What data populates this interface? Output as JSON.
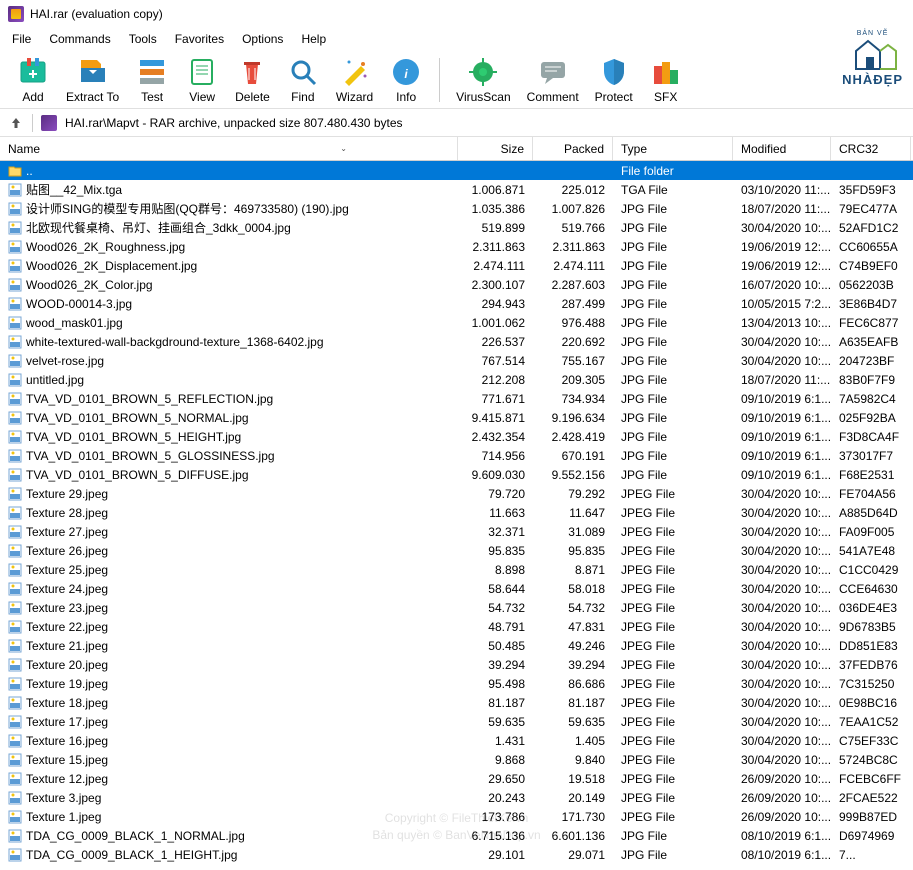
{
  "title": "HAI.rar (evaluation copy)",
  "menus": [
    "File",
    "Commands",
    "Tools",
    "Favorites",
    "Options",
    "Help"
  ],
  "toolbar": [
    {
      "label": "Add",
      "icon": "add"
    },
    {
      "label": "Extract To",
      "icon": "extract"
    },
    {
      "label": "Test",
      "icon": "test"
    },
    {
      "label": "View",
      "icon": "view"
    },
    {
      "label": "Delete",
      "icon": "delete"
    },
    {
      "label": "Find",
      "icon": "find"
    },
    {
      "label": "Wizard",
      "icon": "wizard"
    },
    {
      "label": "Info",
      "icon": "info"
    },
    {
      "label": "VirusScan",
      "icon": "virus"
    },
    {
      "label": "Comment",
      "icon": "comment"
    },
    {
      "label": "Protect",
      "icon": "protect"
    },
    {
      "label": "SFX",
      "icon": "sfx"
    }
  ],
  "brand": {
    "top": "BẢN VẼ",
    "name": "NHÀĐẸP"
  },
  "address": "HAI.rar\\Mapvt - RAR archive, unpacked size 807.480.430 bytes",
  "columns": {
    "name": "Name",
    "size": "Size",
    "packed": "Packed",
    "type": "Type",
    "modified": "Modified",
    "crc": "CRC32"
  },
  "parent": {
    "name": "..",
    "type": "File folder"
  },
  "files": [
    {
      "ico": "img",
      "name": "贴图__42_Mix.tga",
      "size": "1.006.871",
      "packed": "225.012",
      "type": "TGA File",
      "mod": "03/10/2020 11:...",
      "crc": "35FD59F3"
    },
    {
      "ico": "img",
      "name": "设计师SING的模型专用贴图(QQ群号：469733580) (190).jpg",
      "size": "1.035.386",
      "packed": "1.007.826",
      "type": "JPG File",
      "mod": "18/07/2020 11:...",
      "crc": "79EC477A"
    },
    {
      "ico": "img",
      "name": "北欧现代餐桌椅、吊灯、挂画组合_3dkk_0004.jpg",
      "size": "519.899",
      "packed": "519.766",
      "type": "JPG File",
      "mod": "30/04/2020 10:...",
      "crc": "52AFD1C2"
    },
    {
      "ico": "img",
      "name": "Wood026_2K_Roughness.jpg",
      "size": "2.311.863",
      "packed": "2.311.863",
      "type": "JPG File",
      "mod": "19/06/2019 12:...",
      "crc": "CC60655A"
    },
    {
      "ico": "img",
      "name": "Wood026_2K_Displacement.jpg",
      "size": "2.474.111",
      "packed": "2.474.111",
      "type": "JPG File",
      "mod": "19/06/2019 12:...",
      "crc": "C74B9EF0"
    },
    {
      "ico": "img",
      "name": "Wood026_2K_Color.jpg",
      "size": "2.300.107",
      "packed": "2.287.603",
      "type": "JPG File",
      "mod": "16/07/2020 10:...",
      "crc": "0562203B"
    },
    {
      "ico": "img",
      "name": "WOOD-00014-3.jpg",
      "size": "294.943",
      "packed": "287.499",
      "type": "JPG File",
      "mod": "10/05/2015 7:2...",
      "crc": "3E86B4D7"
    },
    {
      "ico": "img",
      "name": "wood_mask01.jpg",
      "size": "1.001.062",
      "packed": "976.488",
      "type": "JPG File",
      "mod": "13/04/2013 10:...",
      "crc": "FEC6C877"
    },
    {
      "ico": "img",
      "name": "white-textured-wall-backgdround-texture_1368-6402.jpg",
      "size": "226.537",
      "packed": "220.692",
      "type": "JPG File",
      "mod": "30/04/2020 10:...",
      "crc": "A635EAFB"
    },
    {
      "ico": "img",
      "name": "velvet-rose.jpg",
      "size": "767.514",
      "packed": "755.167",
      "type": "JPG File",
      "mod": "30/04/2020 10:...",
      "crc": "204723BF"
    },
    {
      "ico": "img",
      "name": "untitled.jpg",
      "size": "212.208",
      "packed": "209.305",
      "type": "JPG File",
      "mod": "18/07/2020 11:...",
      "crc": "83B0F7F9"
    },
    {
      "ico": "img",
      "name": "TVA_VD_0101_BROWN_5_REFLECTION.jpg",
      "size": "771.671",
      "packed": "734.934",
      "type": "JPG File",
      "mod": "09/10/2019 6:1...",
      "crc": "7A5982C4"
    },
    {
      "ico": "img",
      "name": "TVA_VD_0101_BROWN_5_NORMAL.jpg",
      "size": "9.415.871",
      "packed": "9.196.634",
      "type": "JPG File",
      "mod": "09/10/2019 6:1...",
      "crc": "025F92BA"
    },
    {
      "ico": "img",
      "name": "TVA_VD_0101_BROWN_5_HEIGHT.jpg",
      "size": "2.432.354",
      "packed": "2.428.419",
      "type": "JPG File",
      "mod": "09/10/2019 6:1...",
      "crc": "F3D8CA4F"
    },
    {
      "ico": "img",
      "name": "TVA_VD_0101_BROWN_5_GLOSSINESS.jpg",
      "size": "714.956",
      "packed": "670.191",
      "type": "JPG File",
      "mod": "09/10/2019 6:1...",
      "crc": "373017F7"
    },
    {
      "ico": "img",
      "name": "TVA_VD_0101_BROWN_5_DIFFUSE.jpg",
      "size": "9.609.030",
      "packed": "9.552.156",
      "type": "JPG File",
      "mod": "09/10/2019 6:1...",
      "crc": "F68E2531"
    },
    {
      "ico": "img",
      "name": "Texture 29.jpeg",
      "size": "79.720",
      "packed": "79.292",
      "type": "JPEG File",
      "mod": "30/04/2020 10:...",
      "crc": "FE704A56"
    },
    {
      "ico": "img",
      "name": "Texture 28.jpeg",
      "size": "11.663",
      "packed": "11.647",
      "type": "JPEG File",
      "mod": "30/04/2020 10:...",
      "crc": "A885D64D"
    },
    {
      "ico": "img",
      "name": "Texture 27.jpeg",
      "size": "32.371",
      "packed": "31.089",
      "type": "JPEG File",
      "mod": "30/04/2020 10:...",
      "crc": "FA09F005"
    },
    {
      "ico": "img",
      "name": "Texture 26.jpeg",
      "size": "95.835",
      "packed": "95.835",
      "type": "JPEG File",
      "mod": "30/04/2020 10:...",
      "crc": "541A7E48"
    },
    {
      "ico": "img",
      "name": "Texture 25.jpeg",
      "size": "8.898",
      "packed": "8.871",
      "type": "JPEG File",
      "mod": "30/04/2020 10:...",
      "crc": "C1CC0429"
    },
    {
      "ico": "img",
      "name": "Texture 24.jpeg",
      "size": "58.644",
      "packed": "58.018",
      "type": "JPEG File",
      "mod": "30/04/2020 10:...",
      "crc": "CCE64630"
    },
    {
      "ico": "img",
      "name": "Texture 23.jpeg",
      "size": "54.732",
      "packed": "54.732",
      "type": "JPEG File",
      "mod": "30/04/2020 10:...",
      "crc": "036DE4E3"
    },
    {
      "ico": "img",
      "name": "Texture 22.jpeg",
      "size": "48.791",
      "packed": "47.831",
      "type": "JPEG File",
      "mod": "30/04/2020 10:...",
      "crc": "9D6783B5"
    },
    {
      "ico": "img",
      "name": "Texture 21.jpeg",
      "size": "50.485",
      "packed": "49.246",
      "type": "JPEG File",
      "mod": "30/04/2020 10:...",
      "crc": "DD851E83"
    },
    {
      "ico": "img",
      "name": "Texture 20.jpeg",
      "size": "39.294",
      "packed": "39.294",
      "type": "JPEG File",
      "mod": "30/04/2020 10:...",
      "crc": "37FEDB76"
    },
    {
      "ico": "img",
      "name": "Texture 19.jpeg",
      "size": "95.498",
      "packed": "86.686",
      "type": "JPEG File",
      "mod": "30/04/2020 10:...",
      "crc": "7C315250"
    },
    {
      "ico": "img",
      "name": "Texture 18.jpeg",
      "size": "81.187",
      "packed": "81.187",
      "type": "JPEG File",
      "mod": "30/04/2020 10:...",
      "crc": "0E98BC16"
    },
    {
      "ico": "img",
      "name": "Texture 17.jpeg",
      "size": "59.635",
      "packed": "59.635",
      "type": "JPEG File",
      "mod": "30/04/2020 10:...",
      "crc": "7EAA1C52"
    },
    {
      "ico": "img",
      "name": "Texture 16.jpeg",
      "size": "1.431",
      "packed": "1.405",
      "type": "JPEG File",
      "mod": "30/04/2020 10:...",
      "crc": "C75EF33C"
    },
    {
      "ico": "img",
      "name": "Texture 15.jpeg",
      "size": "9.868",
      "packed": "9.840",
      "type": "JPEG File",
      "mod": "30/04/2020 10:...",
      "crc": "5724BC8C"
    },
    {
      "ico": "img",
      "name": "Texture 12.jpeg",
      "size": "29.650",
      "packed": "19.518",
      "type": "JPEG File",
      "mod": "26/09/2020 10:...",
      "crc": "FCEBC6FF"
    },
    {
      "ico": "img",
      "name": "Texture 3.jpeg",
      "size": "20.243",
      "packed": "20.149",
      "type": "JPEG File",
      "mod": "26/09/2020 10:...",
      "crc": "2FCAE522"
    },
    {
      "ico": "img",
      "name": "Texture 1.jpeg",
      "size": "173.786",
      "packed": "171.730",
      "type": "JPEG File",
      "mod": "26/09/2020 10:...",
      "crc": "999B87ED"
    },
    {
      "ico": "img",
      "name": "TDA_CG_0009_BLACK_1_NORMAL.jpg",
      "size": "6.715.136",
      "packed": "6.601.136",
      "type": "JPG File",
      "mod": "08/10/2019 6:1...",
      "crc": "D6974969"
    },
    {
      "ico": "img",
      "name": "TDA_CG_0009_BLACK_1_HEIGHT.jpg",
      "size": "29.101",
      "packed": "29.071",
      "type": "JPG File",
      "mod": "08/10/2019 6:1...",
      "crc": "7..."
    }
  ],
  "watermark": {
    "l1": "Copyright © FileThietKe.vn",
    "l2": "Bản quyền © BanVeNhaDep.vn"
  }
}
